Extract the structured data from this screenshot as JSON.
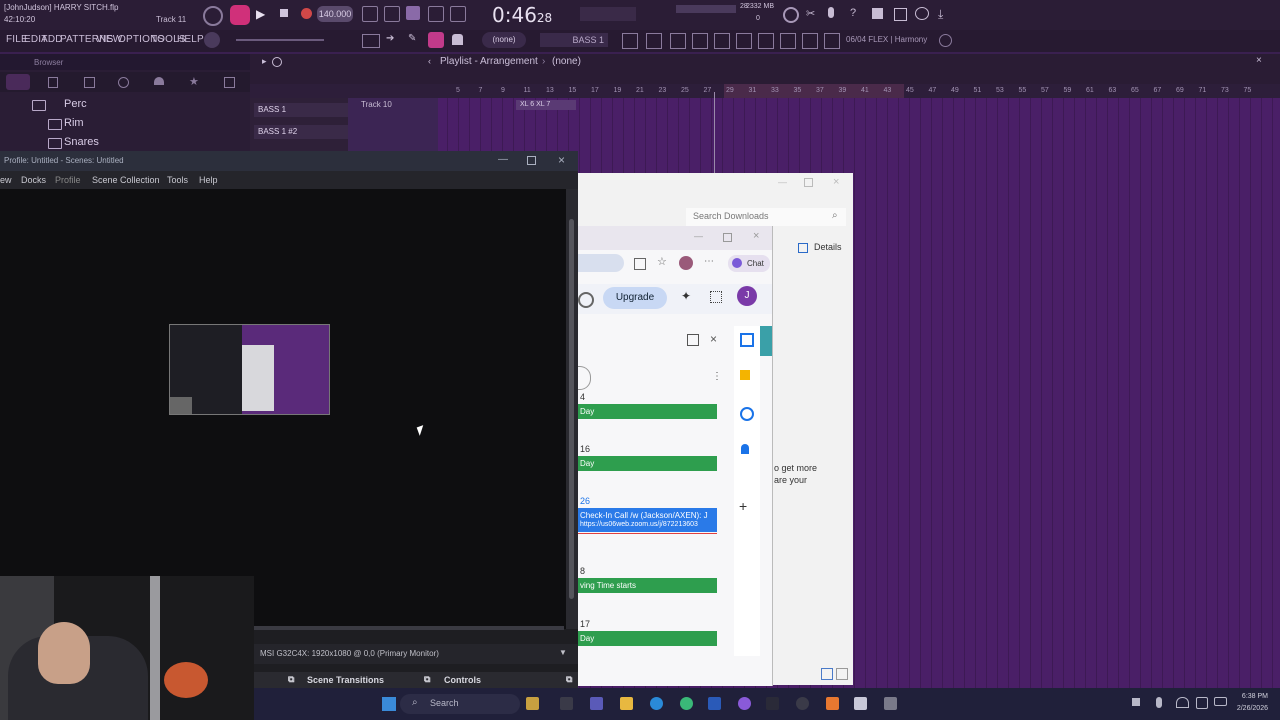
{
  "fl": {
    "file_label": "[JohnJudson] HARRY SITCH.flp",
    "time_label": "42:10:20",
    "track_label": "Track 11",
    "tempo": "140.000",
    "song_time": "0:46",
    "song_time_sub": "28",
    "cpu_value": "28",
    "mem_value": "2332 MB",
    "mem_sub": "0",
    "menu": [
      "FILE",
      "EDIT",
      "ADD",
      "PATTERNS",
      "VIEW",
      "OPTIONS",
      "TOOLS",
      "HELP"
    ],
    "pattern_selector": "(none)",
    "pattern_name": "BASS 1",
    "hint_text": "06/04  FLEX | Harmony",
    "browser_label": "Browser",
    "browser_items": [
      "Perc",
      "Rim",
      "Snares"
    ],
    "channels": [
      "BASS 1",
      "BASS 1 #2"
    ],
    "playlist_title": "Playlist - Arrangement",
    "playlist_pattern": "(none)",
    "track_name": "Track 10",
    "clip_label": "XL 6 XL 7",
    "ruler_numbers": [
      "5",
      "7",
      "9",
      "11",
      "13",
      "15",
      "17",
      "19",
      "21",
      "23",
      "25",
      "27",
      "29",
      "31",
      "33",
      "35",
      "37",
      "39",
      "41",
      "43",
      "45",
      "47",
      "49",
      "51",
      "53",
      "55",
      "57",
      "59",
      "61",
      "63",
      "65",
      "67",
      "69",
      "71",
      "73",
      "75"
    ]
  },
  "obs": {
    "title": "Profile: Untitled - Scenes: Untitled",
    "menu": [
      "ew",
      "Docks",
      "Profile",
      "Scene Collection",
      "Tools",
      "Help"
    ],
    "source_selector": "MSI G32C4X: 1920x1080 @ 0,0 (Primary Monitor)",
    "dock_scene_transitions": "Scene Transitions",
    "dock_controls": "Controls"
  },
  "explorer": {
    "search_placeholder": "Search Downloads",
    "details_label": "Details",
    "promo_line1": "o get more",
    "promo_line2": "are your"
  },
  "chrome": {
    "chat_label": "Chat",
    "upgrade_label": "Upgrade",
    "avatar_letter": "J",
    "calendar": [
      {
        "day": "4",
        "event": "Day"
      },
      {
        "day": "16",
        "event": "Day"
      },
      {
        "day": "26",
        "event": "Check-In Call /w (Jackson/AXEN): J",
        "link": "https://us06web.zoom.us/j/872213603"
      },
      {
        "day": "8",
        "event": "ving Time starts"
      },
      {
        "day": "17",
        "event": "Day"
      }
    ]
  },
  "taskbar": {
    "search_placeholder": "Search",
    "clock_time": "6:38 PM",
    "clock_date": "2/26/2026"
  },
  "colors": {
    "fl_purple": "#4a1f67",
    "event_green": "#2e9e4e",
    "accent_blue": "#1a73e8"
  }
}
